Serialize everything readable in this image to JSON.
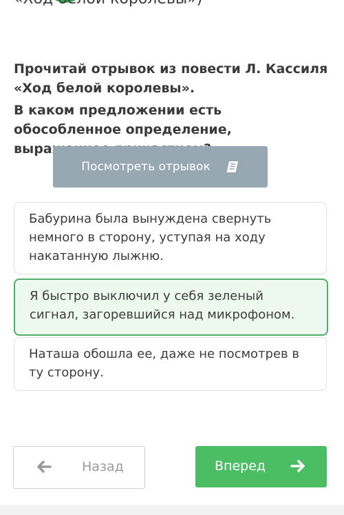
{
  "header": {
    "cut_title": "«Ход белой королевы»)"
  },
  "task": {
    "instruction": "Прочитай отрывок из повести Л. Кассиля «Ход белой королевы».",
    "question": "В каком предложении есть обособленное определение, выраженное причастием?"
  },
  "excerpt_button": {
    "label": "Посмотреть отрывок",
    "icon": "book-icon"
  },
  "options": [
    {
      "text": "Бабурина была вынуждена свернуть немного в сторону, уступая на ходу накатанную лыжню.",
      "selected": false
    },
    {
      "text": "Я быстро выключил у себя зеленый сигнал, загоревшийся над микрофоном.",
      "selected": true
    },
    {
      "text": "Наташа обошла ее, даже не посмотрев в ту сторону.",
      "selected": false
    }
  ],
  "navigation": {
    "back_label": "Назад",
    "next_label": "Вперед",
    "back_icon": "arrow-left-icon",
    "next_icon": "arrow-right-icon"
  },
  "colors": {
    "accent_green": "#4bbd63",
    "selected_border": "#4fae67",
    "selected_bg": "#edf8ef",
    "excerpt_button_bg": "#97a8b3"
  }
}
